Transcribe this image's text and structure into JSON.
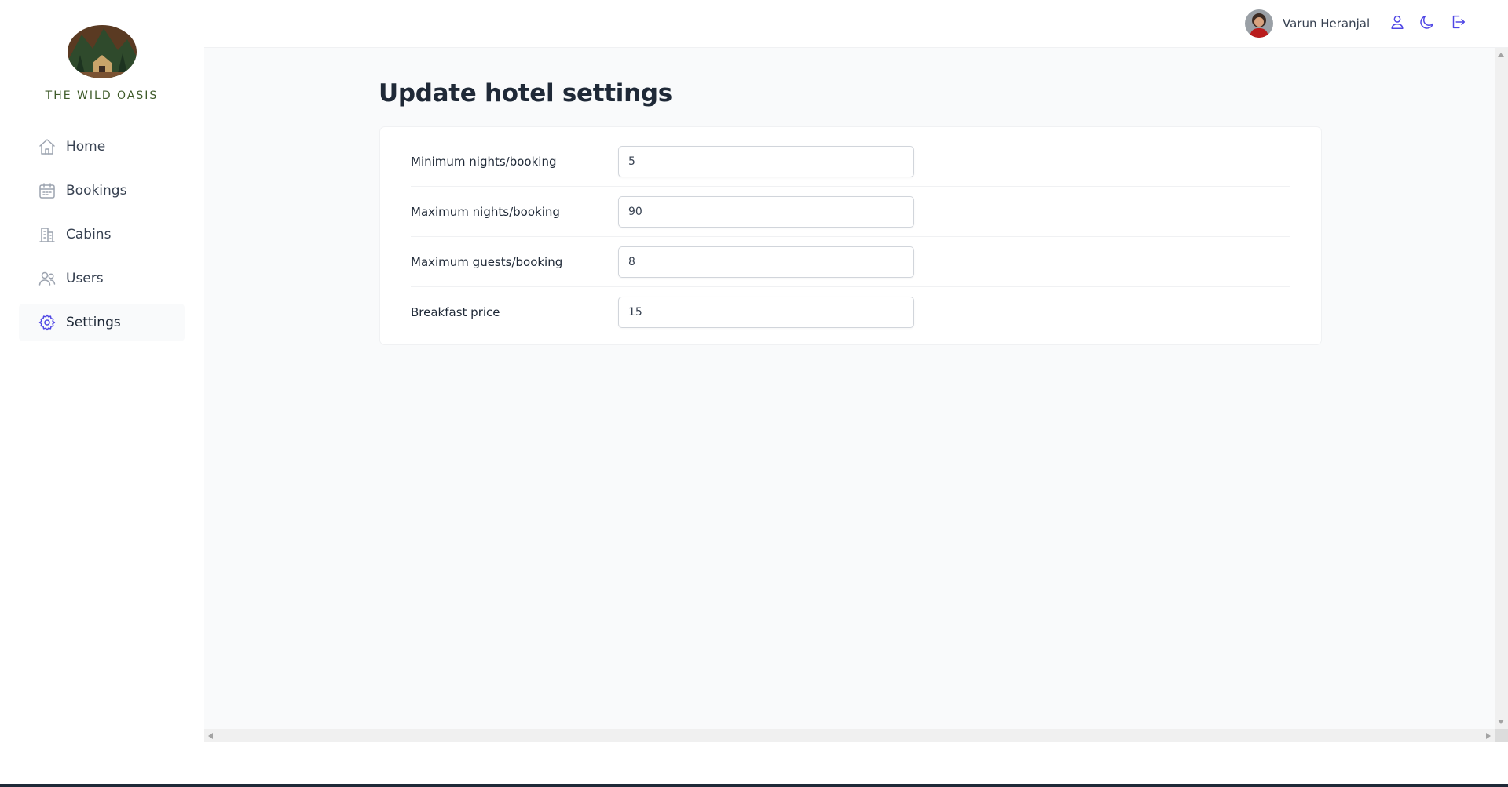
{
  "brand": {
    "name": "THE WILD OASIS",
    "colors": {
      "text": "#3f5b2a",
      "mountain": "#2f4a2c",
      "sky": "#3b2a22"
    }
  },
  "sidebar": {
    "items": [
      {
        "label": "Home",
        "icon": "home-icon",
        "active": false
      },
      {
        "label": "Bookings",
        "icon": "calendar-icon",
        "active": false
      },
      {
        "label": "Cabins",
        "icon": "building-icon",
        "active": false
      },
      {
        "label": "Users",
        "icon": "users-icon",
        "active": false
      },
      {
        "label": "Settings",
        "icon": "gear-icon",
        "active": true
      }
    ]
  },
  "header": {
    "user_name": "Varun Heranjal",
    "icons": [
      "user-icon",
      "moon-icon",
      "logout-icon"
    ],
    "accent": "#4f46e5"
  },
  "main": {
    "title": "Update hotel settings",
    "form": {
      "fields": [
        {
          "label": "Minimum nights/booking",
          "value": "5"
        },
        {
          "label": "Maximum nights/booking",
          "value": "90"
        },
        {
          "label": "Maximum guests/booking",
          "value": "8"
        },
        {
          "label": "Breakfast price",
          "value": "15"
        }
      ]
    }
  }
}
